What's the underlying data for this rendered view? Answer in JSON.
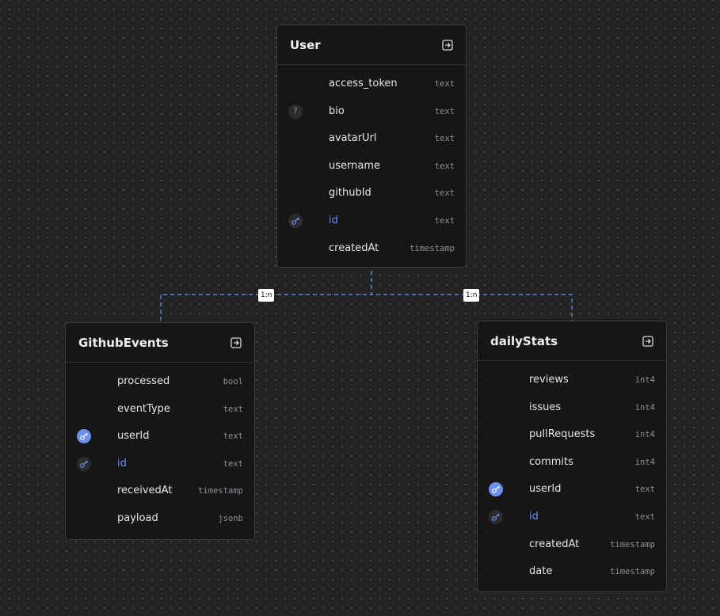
{
  "tables": {
    "user": {
      "name": "User",
      "fields": [
        {
          "name": "access_token",
          "type": "text"
        },
        {
          "name": "bio",
          "type": "text",
          "badge": "?"
        },
        {
          "name": "avatarUrl",
          "type": "text"
        },
        {
          "name": "username",
          "type": "text"
        },
        {
          "name": "githubId",
          "type": "text"
        },
        {
          "name": "id",
          "type": "text"
        },
        {
          "name": "createdAt",
          "type": "timestamp"
        }
      ]
    },
    "githubEvents": {
      "name": "GithubEvents",
      "fields": [
        {
          "name": "processed",
          "type": "bool"
        },
        {
          "name": "eventType",
          "type": "text"
        },
        {
          "name": "userId",
          "type": "text"
        },
        {
          "name": "id",
          "type": "text"
        },
        {
          "name": "receivedAt",
          "type": "timestamp"
        },
        {
          "name": "payload",
          "type": "jsonb"
        }
      ]
    },
    "dailyStats": {
      "name": "dailyStats",
      "fields": [
        {
          "name": "reviews",
          "type": "int4"
        },
        {
          "name": "issues",
          "type": "int4"
        },
        {
          "name": "pullRequests",
          "type": "int4"
        },
        {
          "name": "commits",
          "type": "int4"
        },
        {
          "name": "userId",
          "type": "text"
        },
        {
          "name": "id",
          "type": "text"
        },
        {
          "name": "createdAt",
          "type": "timestamp"
        },
        {
          "name": "date",
          "type": "timestamp"
        }
      ]
    }
  },
  "relations": {
    "user_githubEvents": "1:n",
    "user_dailyStats": "1:n"
  },
  "colors": {
    "primary_key": "#6d8ff0",
    "edge": "#6d8ff0",
    "background": "#232325",
    "card": "#161618"
  }
}
